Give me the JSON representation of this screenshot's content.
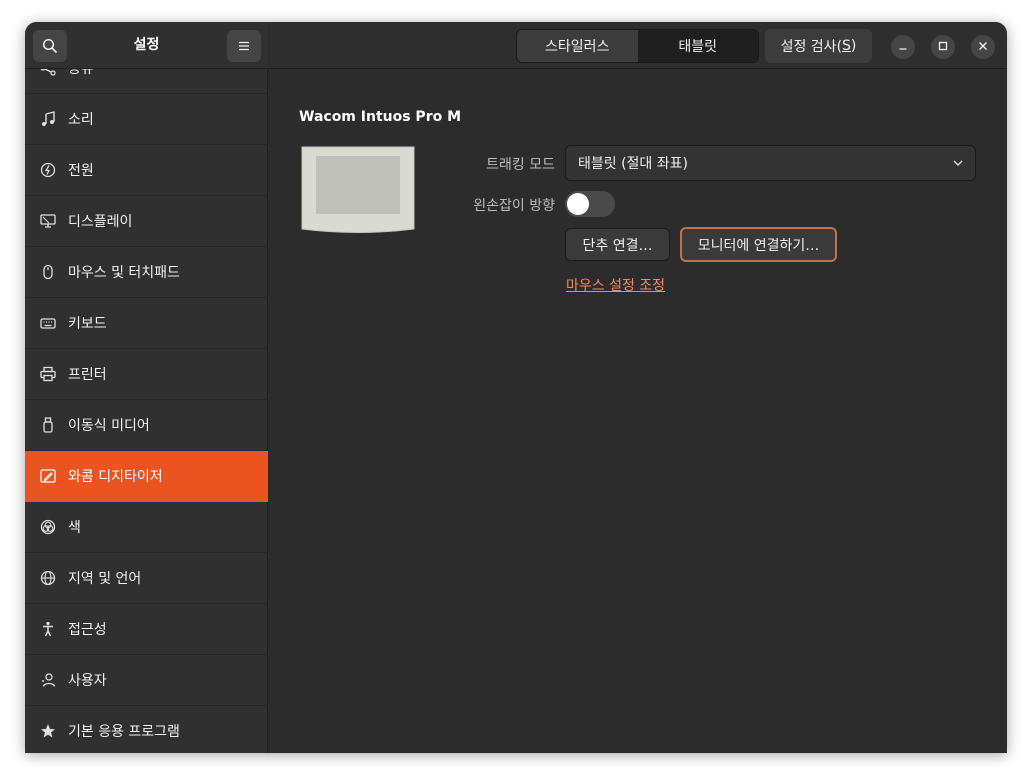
{
  "sidebar": {
    "title": "설정",
    "search_icon": "search-icon",
    "menu_icon": "hamburger-menu-icon",
    "partial_item": "공유",
    "items": [
      {
        "label": "소리",
        "icon": "music-note-icon"
      },
      {
        "label": "전원",
        "icon": "power-icon"
      },
      {
        "label": "디스플레이",
        "icon": "display-icon"
      },
      {
        "label": "마우스 및 터치패드",
        "icon": "mouse-icon"
      },
      {
        "label": "키보드",
        "icon": "keyboard-icon"
      },
      {
        "label": "프린터",
        "icon": "printer-icon"
      },
      {
        "label": "이동식 미디어",
        "icon": "removable-media-icon"
      },
      {
        "label": "와콤 디지타이저",
        "icon": "wacom-tablet-icon",
        "active": true
      },
      {
        "label": "색",
        "icon": "color-icon"
      },
      {
        "label": "지역 및 언어",
        "icon": "globe-icon"
      },
      {
        "label": "접근성",
        "icon": "accessibility-icon"
      },
      {
        "label": "사용자",
        "icon": "users-icon"
      },
      {
        "label": "기본 응용 프로그램",
        "icon": "star-icon"
      }
    ]
  },
  "header": {
    "tabs": [
      {
        "label": "스타일러스",
        "active": false
      },
      {
        "label": "태블릿",
        "active": true
      }
    ],
    "check_button": {
      "prefix": "설정 검사(",
      "mnemonic": "S",
      "suffix": ")"
    },
    "window_controls": [
      "minimize-icon",
      "maximize-icon",
      "close-icon"
    ]
  },
  "main": {
    "device_name": "Wacom Intuos Pro M",
    "tracking_mode_label": "트래킹 모드",
    "tracking_mode_value": "태블릿 (절대 좌표)",
    "left_handed_label": "왼손잡이 방향",
    "left_handed_on": false,
    "map_buttons_label": "단추 연결…",
    "map_monitor_label": "모니터에 연결하기…",
    "mouse_settings_link": "마우스 설정 조정"
  },
  "colors": {
    "accent": "#e95420",
    "link": "#f08a68",
    "focus_ring": "#c2704d",
    "window_bg": "#2c2c2c",
    "sidebar_bg": "#303030"
  }
}
